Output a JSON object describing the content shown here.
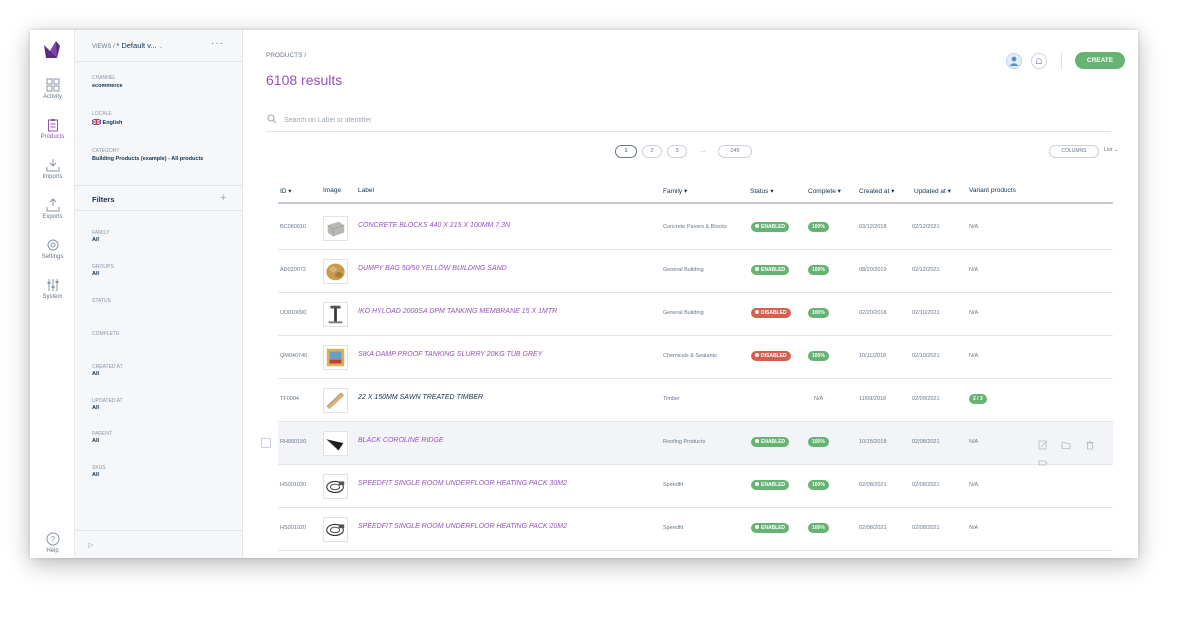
{
  "nav": {
    "items": [
      {
        "label": "Activity",
        "icon": "dashboard-grid-icon"
      },
      {
        "label": "Products",
        "icon": "clipboard-icon"
      },
      {
        "label": "Imports",
        "icon": "import-icon"
      },
      {
        "label": "Exports",
        "icon": "export-icon"
      },
      {
        "label": "Settings",
        "icon": "gear-icon"
      },
      {
        "label": "System",
        "icon": "sliders-icon"
      }
    ],
    "help_label": "Help"
  },
  "side": {
    "views_prefix": "VIEWS /",
    "views_value": "* Default v...",
    "more": "···",
    "channel_label": "CHANNEL",
    "channel_value": "ecommerce",
    "locale_label": "LOCALE",
    "locale_value": "English",
    "category_label": "CATEGORY",
    "category_value": "Building Products (example) - All products",
    "filters_title": "Filters",
    "filters_add": "+",
    "filters": [
      {
        "label": "FAMILY",
        "value": "All"
      },
      {
        "label": "GROUPS",
        "value": "All"
      },
      {
        "label": "STATUS",
        "value": ""
      },
      {
        "label": "COMPLETE",
        "value": ""
      },
      {
        "label": "CREATED AT",
        "value": "All"
      },
      {
        "label": "UPDATED AT",
        "value": "All"
      },
      {
        "label": "PARENT",
        "value": "All"
      },
      {
        "label": "SKUS",
        "value": "All"
      }
    ]
  },
  "main": {
    "breadcrumb": "PRODUCTS /",
    "results": "6108 results",
    "create_label": "CREATE",
    "search_placeholder": "Search on Label or identifier",
    "pages": [
      "1",
      "2",
      "3",
      "...",
      "245"
    ],
    "columns_label": "COLUMNS",
    "list_label": "List ⌄"
  },
  "table": {
    "headers": {
      "id": "ID ▾",
      "image": "Image",
      "label": "Label",
      "family": "Family ▾",
      "status": "Status ▾",
      "complete": "Complete ▾",
      "created": "Created at ▾",
      "updated": "Updated at ▾",
      "variant": "Variant products"
    },
    "rows": [
      {
        "id": "BC060010",
        "label": "CONCRETE BLOCKS 440 X 215 X 100MM 7.3N",
        "family": "Concrete Pavers & Blocks",
        "status": "ENABLED",
        "complete": "100%",
        "created": "03/12/2018",
        "updated": "02/12/2021",
        "variant": "N/A"
      },
      {
        "id": "AD020072",
        "label": "DUMPY BAG 50/50 YELLOW BUILDING SAND",
        "family": "General Building",
        "status": "ENABLED",
        "complete": "100%",
        "created": "08/20/2019",
        "updated": "02/12/2021",
        "variant": "N/A"
      },
      {
        "id": "UD010090",
        "label": "IKO HYLOAD 2000SA DPM TANKING MEMBRANE 15 X 1MTR",
        "family": "General Building",
        "status": "DISABLED",
        "complete": "100%",
        "created": "02/20/2018",
        "updated": "02/10/2021",
        "variant": "N/A"
      },
      {
        "id": "QM040740",
        "label": "SIKA DAMP PROOF TANKING SLURRY 20KG TUB GREY",
        "family": "Chemicals & Sealants",
        "status": "DISABLED",
        "complete": "100%",
        "created": "10/11/2018",
        "updated": "02/10/2021",
        "variant": "N/A"
      },
      {
        "id": "TF0004",
        "label": "22 X 150MM SAWN TREATED TIMBER",
        "family": "Timber",
        "status": "",
        "complete": "N/A",
        "created": "11/09/2018",
        "updated": "02/09/2021",
        "variant": "2 / 3"
      },
      {
        "id": "RH000150",
        "label": "BLACK COROLINE RIDGE",
        "family": "Roofing Products",
        "status": "ENABLED",
        "complete": "100%",
        "created": "10/15/2018",
        "updated": "02/08/2021",
        "variant": "N/A"
      },
      {
        "id": "HS001030",
        "label": "SPEEDFIT SINGLE ROOM UNDERFLOOR HEATING PACK 30M2",
        "family": "Speedfit",
        "status": "ENABLED",
        "complete": "100%",
        "created": "02/08/2021",
        "updated": "02/08/2021",
        "variant": "N/A"
      },
      {
        "id": "HS001020",
        "label": "SPEEDFIT SINGLE ROOM UNDERFLOOR HEATING PACK 20M2",
        "family": "Speedfit",
        "status": "ENABLED",
        "complete": "100%",
        "created": "02/08/2021",
        "updated": "02/08/2021",
        "variant": "N/A"
      }
    ]
  },
  "colors": {
    "accent": "#9452ba",
    "enabled": "#67b373",
    "disabled": "#d4604f",
    "text_dark": "#11324d",
    "text_muted": "#67768a"
  }
}
